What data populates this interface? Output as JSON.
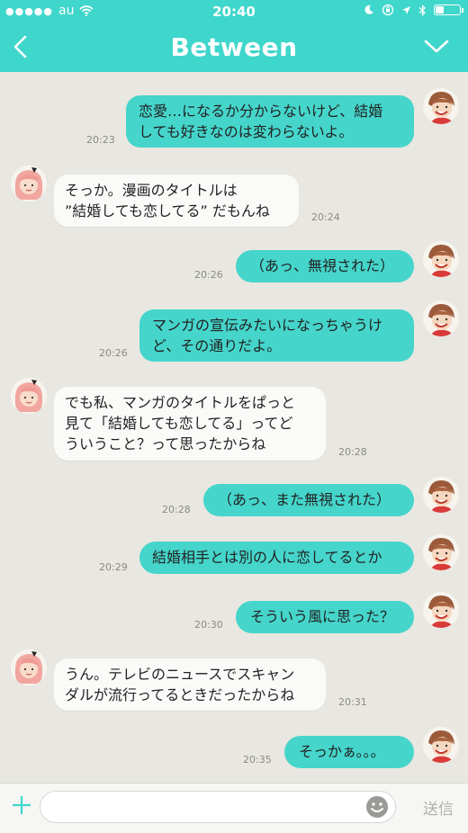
{
  "status_bar": {
    "signal": "●●●●●",
    "carrier": "au",
    "time": "20:40"
  },
  "header": {
    "title": "Between",
    "back_icon": "chevron-left-icon",
    "menu_icon": "chevron-down-icon"
  },
  "messages": [
    {
      "from": "me",
      "lines": [
        "恋愛…になるか分からないけど、結婚",
        "しても好きなのは変わらないよ。"
      ],
      "time": "20:23"
    },
    {
      "from": "them",
      "lines": [
        "そっか。漫画のタイトルは",
        "”結婚しても恋してる” だもんね"
      ],
      "time": "20:24"
    },
    {
      "from": "me",
      "lines": [
        "（あっ、無視された）"
      ],
      "time": "20:26"
    },
    {
      "from": "me",
      "lines": [
        "マンガの宣伝みたいになっちゃうけ",
        "ど、その通りだよ。"
      ],
      "time": "20:26"
    },
    {
      "from": "them",
      "lines": [
        "でも私、マンガのタイトルをぱっと",
        "見て「結婚しても恋してる」ってど",
        "ういうこと？って思ったからね"
      ],
      "time": "20:28"
    },
    {
      "from": "me",
      "lines": [
        "（あっ、また無視された）"
      ],
      "time": "20:28"
    },
    {
      "from": "me",
      "lines": [
        "結婚相手とは別の人に恋してるとか"
      ],
      "time": "20:29"
    },
    {
      "from": "me",
      "lines": [
        "そういう風に思った？"
      ],
      "time": "20:30"
    },
    {
      "from": "them",
      "lines": [
        "うん。テレビのニュースでスキャン",
        "ダルが流行ってるときだったからね"
      ],
      "time": "20:31"
    },
    {
      "from": "me",
      "lines": [
        "そっかぁ。。。"
      ],
      "time": "20:35"
    }
  ],
  "input": {
    "placeholder": "",
    "send_label": "送信"
  },
  "colors": {
    "accent": "#3fd6cb",
    "my_bubble": "#45d5cb",
    "their_bubble": "#fafaf8",
    "background": "#e9e7e1"
  }
}
